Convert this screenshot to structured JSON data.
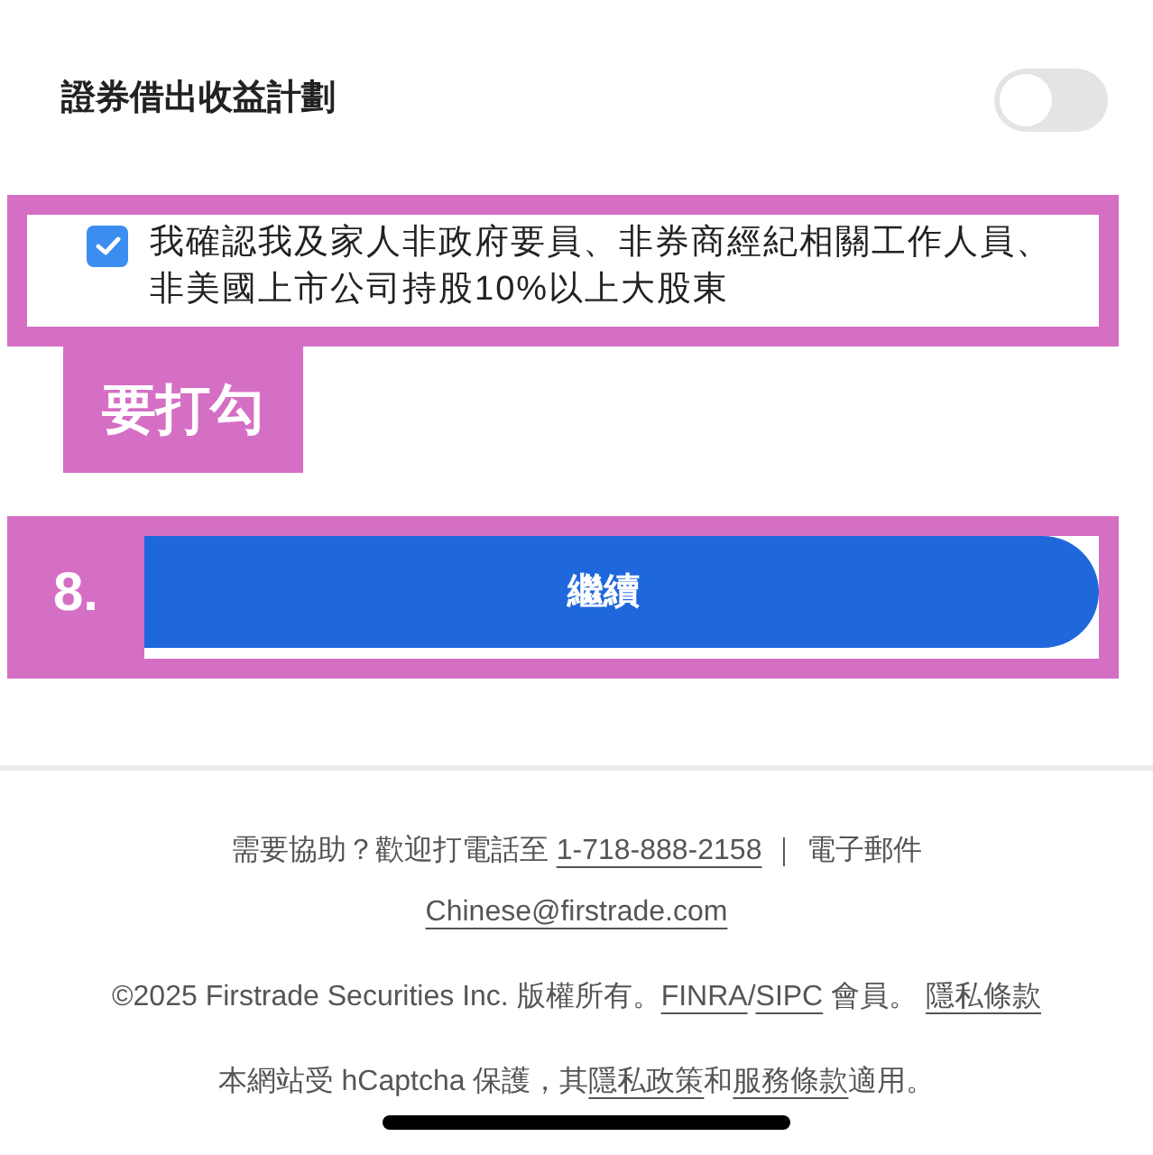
{
  "setting": {
    "label": "證券借出收益計劃",
    "on": false
  },
  "consent": {
    "checked": true,
    "text": "我確認我及家人非政府要員、非券商經紀相關工作人員、非美國上市公司持股10%以上大股東"
  },
  "continue_button": {
    "label": "繼續"
  },
  "annotations": [
    {
      "kind": "consent_frame"
    },
    {
      "kind": "note",
      "text": "要打勾"
    },
    {
      "kind": "button_frame"
    },
    {
      "kind": "step",
      "text": "8."
    }
  ],
  "footer": [
    [
      {
        "text": "需要協助？歡迎打電話至 ",
        "link": false
      },
      {
        "text": "1-718-888-2158",
        "link": true
      },
      {
        "text": " ｜ 電子郵件 ",
        "link": false
      },
      {
        "text": "Chinese@firstrade.com",
        "link": true
      }
    ],
    [
      {
        "text": "©2025 Firstrade Securities Inc. 版權所有。",
        "link": false
      },
      {
        "text": "FINRA",
        "link": true
      },
      {
        "text": "/",
        "link": false
      },
      {
        "text": "SIPC",
        "link": true
      },
      {
        "text": " 會員。 ",
        "link": false
      },
      {
        "text": "隱私條款",
        "link": true
      }
    ],
    [
      {
        "text": "本網站受 hCaptcha 保護，其",
        "link": false
      },
      {
        "text": "隱私政策",
        "link": true
      },
      {
        "text": "和",
        "link": false
      },
      {
        "text": "服務條款",
        "link": true
      },
      {
        "text": "適用。",
        "link": false
      }
    ]
  ]
}
